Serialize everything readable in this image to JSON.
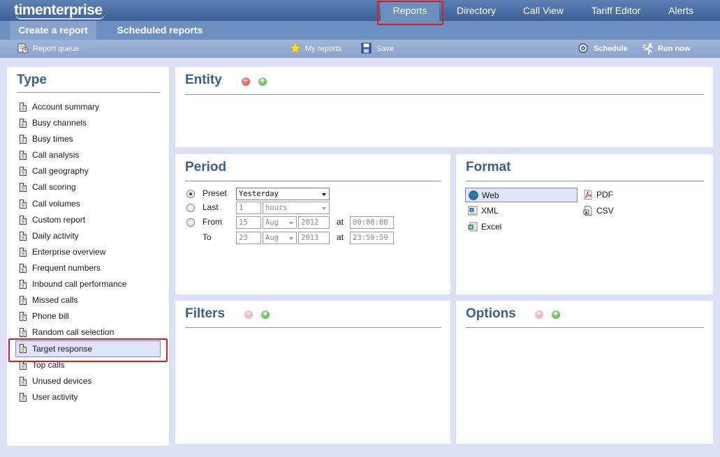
{
  "app": {
    "logo": "timenterprise"
  },
  "top_nav": {
    "items": [
      {
        "label": "Reports",
        "active": true
      },
      {
        "label": "Directory",
        "active": false
      },
      {
        "label": "Call View",
        "active": false
      },
      {
        "label": "Tariff Editor",
        "active": false
      },
      {
        "label": "Alerts",
        "active": false
      }
    ]
  },
  "sub_tabs": {
    "items": [
      {
        "label": "Create a report",
        "active": true
      },
      {
        "label": "Scheduled reports",
        "active": false
      }
    ]
  },
  "toolbar": {
    "report_queue": "Report queue",
    "my_reports": "My reports",
    "save": "Save",
    "schedule": "Schedule",
    "run_now": "Run now"
  },
  "type_panel": {
    "title": "Type",
    "items": [
      "Account summary",
      "Busy channels",
      "Busy times",
      "Call analysis",
      "Call geography",
      "Call scoring",
      "Call volumes",
      "Custom report",
      "Daily activity",
      "Enterprise overview",
      "Frequent numbers",
      "Inbound call performance",
      "Missed calls",
      "Phone bill",
      "Random call selection",
      "Target response",
      "Top calls",
      "Unused devices",
      "User activity"
    ],
    "selected": "Target response"
  },
  "entity_panel": {
    "title": "Entity"
  },
  "period_panel": {
    "title": "Period",
    "preset_label": "Preset",
    "preset_value": "Yesterday",
    "last_label": "Last",
    "last_amount": "1",
    "last_unit": "hours",
    "from_label": "From",
    "from_day": "15",
    "from_month": "Aug",
    "from_year": "2012",
    "from_at": "at",
    "from_time": "00:00:00",
    "to_label": "To",
    "to_day": "23",
    "to_month": "Aug",
    "to_year": "2013",
    "to_at": "at",
    "to_time": "23:59:59",
    "selected_option": "Preset"
  },
  "format_panel": {
    "title": "Format",
    "options": [
      "Web",
      "PDF",
      "XML",
      "CSV",
      "Excel"
    ],
    "selected": "Web"
  },
  "filters_panel": {
    "title": "Filters"
  },
  "options_panel": {
    "title": "Options"
  },
  "colors": {
    "header_blue": "#3f6296",
    "title_blue": "#3d5f8e",
    "highlight_red": "#e01b22",
    "selected_bg": "#dfe4fb",
    "page_bg": "#dde0f5"
  }
}
